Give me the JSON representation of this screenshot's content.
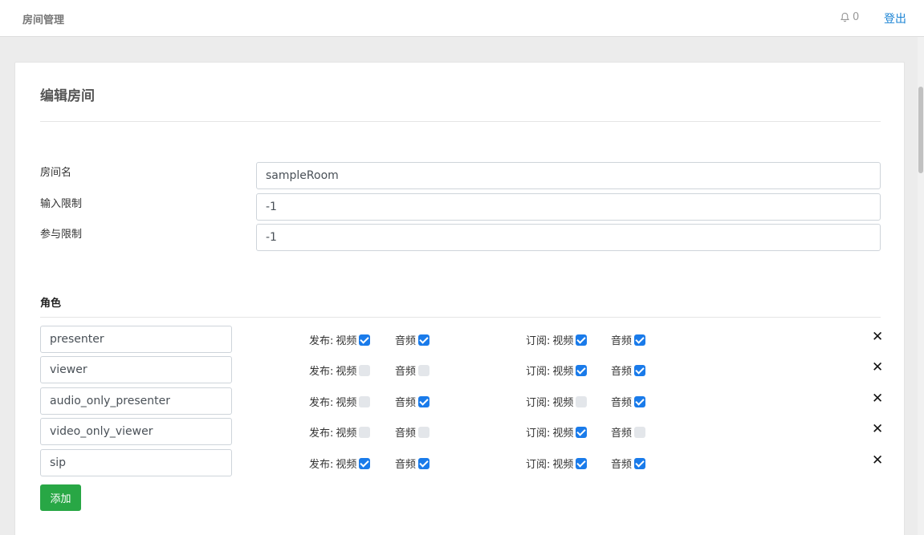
{
  "header": {
    "brand": "房间管理",
    "notification_count": "0",
    "logout_label": "登出"
  },
  "form": {
    "title": "编辑房间",
    "fields": [
      {
        "label": "房间名",
        "value": "sampleRoom"
      },
      {
        "label": "输入限制",
        "value": "-1"
      },
      {
        "label": "参与限制",
        "value": "-1"
      }
    ]
  },
  "roles_section": {
    "title": "角色",
    "publish_label": "发布:",
    "subscribe_label": "订阅:",
    "video_label": "视频",
    "audio_label": "音频",
    "delete_symbol": "✕",
    "add_label": "添加",
    "roles": [
      {
        "name": "presenter",
        "publish_video": true,
        "publish_audio": true,
        "subscribe_video": true,
        "subscribe_audio": true
      },
      {
        "name": "viewer",
        "publish_video": false,
        "publish_audio": false,
        "subscribe_video": true,
        "subscribe_audio": true
      },
      {
        "name": "audio_only_presenter",
        "publish_video": false,
        "publish_audio": true,
        "subscribe_video": false,
        "subscribe_audio": true
      },
      {
        "name": "video_only_viewer",
        "publish_video": false,
        "publish_audio": false,
        "subscribe_video": true,
        "subscribe_audio": false
      },
      {
        "name": "sip",
        "publish_video": true,
        "publish_audio": true,
        "subscribe_video": true,
        "subscribe_audio": true
      }
    ]
  },
  "colors": {
    "accent": "#1a83d4",
    "checkbox_on": "#1a7bea",
    "add_button": "#28a745"
  }
}
